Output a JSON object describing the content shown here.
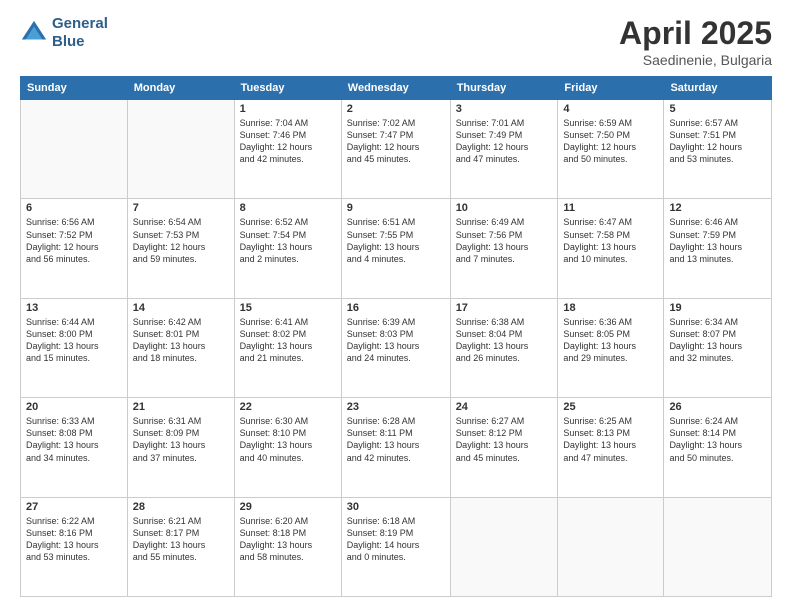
{
  "header": {
    "logo_line1": "General",
    "logo_line2": "Blue",
    "month": "April 2025",
    "location": "Saedinenie, Bulgaria"
  },
  "days_of_week": [
    "Sunday",
    "Monday",
    "Tuesday",
    "Wednesday",
    "Thursday",
    "Friday",
    "Saturday"
  ],
  "weeks": [
    [
      {
        "day": "",
        "info": ""
      },
      {
        "day": "",
        "info": ""
      },
      {
        "day": "1",
        "info": "Sunrise: 7:04 AM\nSunset: 7:46 PM\nDaylight: 12 hours\nand 42 minutes."
      },
      {
        "day": "2",
        "info": "Sunrise: 7:02 AM\nSunset: 7:47 PM\nDaylight: 12 hours\nand 45 minutes."
      },
      {
        "day": "3",
        "info": "Sunrise: 7:01 AM\nSunset: 7:49 PM\nDaylight: 12 hours\nand 47 minutes."
      },
      {
        "day": "4",
        "info": "Sunrise: 6:59 AM\nSunset: 7:50 PM\nDaylight: 12 hours\nand 50 minutes."
      },
      {
        "day": "5",
        "info": "Sunrise: 6:57 AM\nSunset: 7:51 PM\nDaylight: 12 hours\nand 53 minutes."
      }
    ],
    [
      {
        "day": "6",
        "info": "Sunrise: 6:56 AM\nSunset: 7:52 PM\nDaylight: 12 hours\nand 56 minutes."
      },
      {
        "day": "7",
        "info": "Sunrise: 6:54 AM\nSunset: 7:53 PM\nDaylight: 12 hours\nand 59 minutes."
      },
      {
        "day": "8",
        "info": "Sunrise: 6:52 AM\nSunset: 7:54 PM\nDaylight: 13 hours\nand 2 minutes."
      },
      {
        "day": "9",
        "info": "Sunrise: 6:51 AM\nSunset: 7:55 PM\nDaylight: 13 hours\nand 4 minutes."
      },
      {
        "day": "10",
        "info": "Sunrise: 6:49 AM\nSunset: 7:56 PM\nDaylight: 13 hours\nand 7 minutes."
      },
      {
        "day": "11",
        "info": "Sunrise: 6:47 AM\nSunset: 7:58 PM\nDaylight: 13 hours\nand 10 minutes."
      },
      {
        "day": "12",
        "info": "Sunrise: 6:46 AM\nSunset: 7:59 PM\nDaylight: 13 hours\nand 13 minutes."
      }
    ],
    [
      {
        "day": "13",
        "info": "Sunrise: 6:44 AM\nSunset: 8:00 PM\nDaylight: 13 hours\nand 15 minutes."
      },
      {
        "day": "14",
        "info": "Sunrise: 6:42 AM\nSunset: 8:01 PM\nDaylight: 13 hours\nand 18 minutes."
      },
      {
        "day": "15",
        "info": "Sunrise: 6:41 AM\nSunset: 8:02 PM\nDaylight: 13 hours\nand 21 minutes."
      },
      {
        "day": "16",
        "info": "Sunrise: 6:39 AM\nSunset: 8:03 PM\nDaylight: 13 hours\nand 24 minutes."
      },
      {
        "day": "17",
        "info": "Sunrise: 6:38 AM\nSunset: 8:04 PM\nDaylight: 13 hours\nand 26 minutes."
      },
      {
        "day": "18",
        "info": "Sunrise: 6:36 AM\nSunset: 8:05 PM\nDaylight: 13 hours\nand 29 minutes."
      },
      {
        "day": "19",
        "info": "Sunrise: 6:34 AM\nSunset: 8:07 PM\nDaylight: 13 hours\nand 32 minutes."
      }
    ],
    [
      {
        "day": "20",
        "info": "Sunrise: 6:33 AM\nSunset: 8:08 PM\nDaylight: 13 hours\nand 34 minutes."
      },
      {
        "day": "21",
        "info": "Sunrise: 6:31 AM\nSunset: 8:09 PM\nDaylight: 13 hours\nand 37 minutes."
      },
      {
        "day": "22",
        "info": "Sunrise: 6:30 AM\nSunset: 8:10 PM\nDaylight: 13 hours\nand 40 minutes."
      },
      {
        "day": "23",
        "info": "Sunrise: 6:28 AM\nSunset: 8:11 PM\nDaylight: 13 hours\nand 42 minutes."
      },
      {
        "day": "24",
        "info": "Sunrise: 6:27 AM\nSunset: 8:12 PM\nDaylight: 13 hours\nand 45 minutes."
      },
      {
        "day": "25",
        "info": "Sunrise: 6:25 AM\nSunset: 8:13 PM\nDaylight: 13 hours\nand 47 minutes."
      },
      {
        "day": "26",
        "info": "Sunrise: 6:24 AM\nSunset: 8:14 PM\nDaylight: 13 hours\nand 50 minutes."
      }
    ],
    [
      {
        "day": "27",
        "info": "Sunrise: 6:22 AM\nSunset: 8:16 PM\nDaylight: 13 hours\nand 53 minutes."
      },
      {
        "day": "28",
        "info": "Sunrise: 6:21 AM\nSunset: 8:17 PM\nDaylight: 13 hours\nand 55 minutes."
      },
      {
        "day": "29",
        "info": "Sunrise: 6:20 AM\nSunset: 8:18 PM\nDaylight: 13 hours\nand 58 minutes."
      },
      {
        "day": "30",
        "info": "Sunrise: 6:18 AM\nSunset: 8:19 PM\nDaylight: 14 hours\nand 0 minutes."
      },
      {
        "day": "",
        "info": ""
      },
      {
        "day": "",
        "info": ""
      },
      {
        "day": "",
        "info": ""
      }
    ]
  ]
}
